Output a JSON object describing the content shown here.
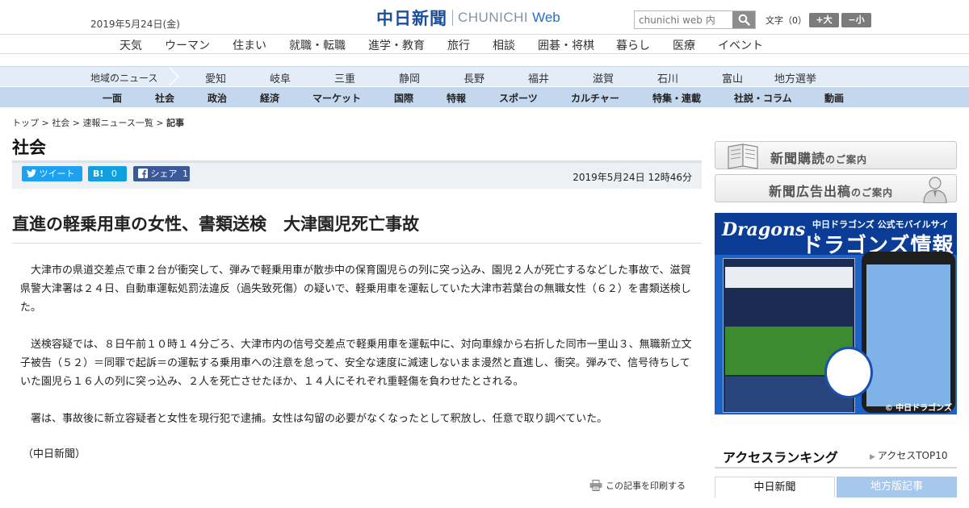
{
  "header": {
    "date": "2019年5月24日(金)",
    "logo_jp": "中日新聞",
    "logo_en": "CHUNICHI",
    "logo_web": "Web",
    "search_placeholder": "chunichi web 内",
    "font_size_label": "文字（0）",
    "font_large": "+大",
    "font_small": "−小"
  },
  "genre_nav": [
    "天気",
    "ウーマン",
    "住まい",
    "就職・転職",
    "進学・教育",
    "旅行",
    "相談",
    "囲碁・将棋",
    "暮らし",
    "医療",
    "イベント"
  ],
  "region_nav": {
    "label": "地域のニュース",
    "items": [
      "愛知",
      "岐阜",
      "三重",
      "静岡",
      "長野",
      "福井",
      "滋賀",
      "石川",
      "富山",
      "地方選挙"
    ]
  },
  "category_nav": [
    "一面",
    "社会",
    "政治",
    "経済",
    "マーケット",
    "国際",
    "特報",
    "スポーツ",
    "カルチャー",
    "特集・連載",
    "社説・コラム",
    "動画"
  ],
  "breadcrumb": {
    "items": [
      "トップ",
      "社会",
      "速報ニュース一覧"
    ],
    "current": "記事",
    "separator": " > "
  },
  "section_title": "社会",
  "share": {
    "tweet": "ツイート",
    "hatena": "B!",
    "hatena_count": "0",
    "facebook": "シェア",
    "facebook_count": "1"
  },
  "article": {
    "published": "2019年5月24日 12時46分",
    "headline": "直進の軽乗用車の女性、書類送検　大津園児死亡事故",
    "paragraphs": [
      "大津市の県道交差点で車２台が衝突して、弾みで軽乗用車が散歩中の保育園児らの列に突っ込み、園児２人が死亡するなどした事故で、滋賀県警大津署は２４日、自動車運転処罰法違反（過失致死傷）の疑いで、軽乗用車を運転していた大津市若葉台の無職女性（６２）を書類送検した。",
      "送検容疑では、８日午前１０時１４分ごろ、大津市内の信号交差点で軽乗用車を運転中に、対向車線から右折した同市一里山３、無職新立文子被告（５２）＝同罪で起訴＝の運転する乗用車への注意を怠って、安全な速度に減速しないまま漫然と直進し、衝突。弾みで、信号待ちしていた園児ら１６人の列に突っ込み、２人を死亡させたほか、１４人にそれぞれ重軽傷を負わせたとされる。",
      "署は、事故後に新立容疑者と女性を現行犯で逮捕。女性は勾留の必要がなくなったとして釈放し、任意で取り調べていた。",
      "（中日新聞）"
    ],
    "print_label": "この記事を印刷する"
  },
  "sidebar": {
    "subscribe_main": "新聞購読",
    "subscribe_suffix": "のご案内",
    "ad_main": "新聞広告出稿",
    "ad_suffix": "のご案内",
    "banner": {
      "brand": "Dragons",
      "subtitle": "中日ドラゴンズ 公式モバイルサイト",
      "title": "ドラゴンズ情報",
      "copyright": "© 中日ドラゴンズ"
    },
    "ranking": {
      "title": "アクセスランキング",
      "link": "アクセスTOP10",
      "tabs": [
        "中日新聞",
        "地方版記事"
      ]
    }
  },
  "colors": {
    "logo_blue": "#1b4f9c",
    "region_bg": "#e3edf7",
    "category_bg": "#c5d7ec",
    "twitter": "#1da1f2",
    "hatena": "#10a0e0",
    "facebook": "#3b5998"
  }
}
